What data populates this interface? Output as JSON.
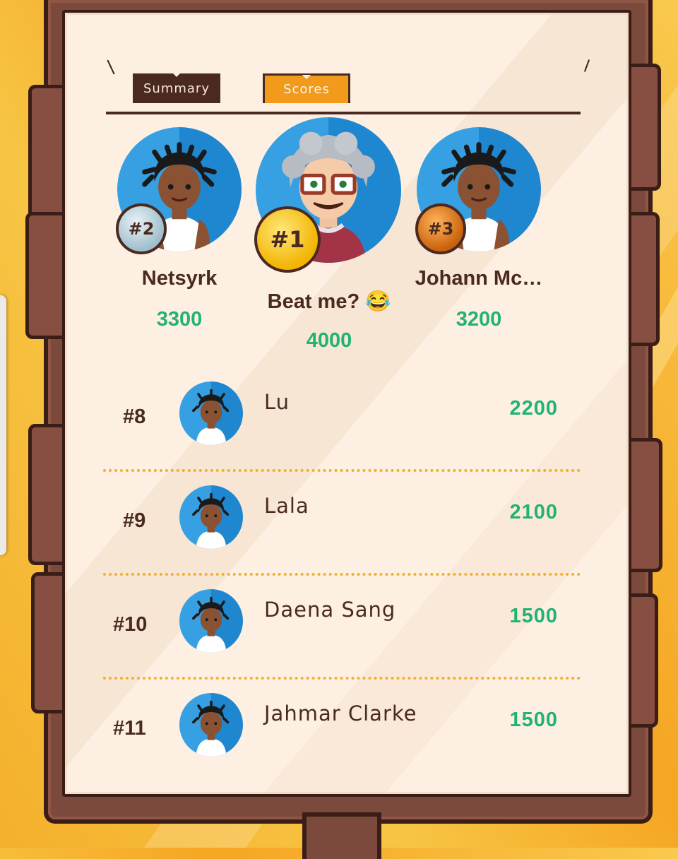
{
  "tabs": {
    "summary": "Summary",
    "scores": "Scores",
    "active": "Scores"
  },
  "podium": [
    {
      "rank_label": "#2",
      "name": "Netsyrk",
      "score": "3300",
      "medal": "silver"
    },
    {
      "rank_label": "#1",
      "name": "Beat me? 😂",
      "score": "4000",
      "medal": "gold"
    },
    {
      "rank_label": "#3",
      "name": "Johann Mc…",
      "score": "3200",
      "medal": "bronze"
    }
  ],
  "list": [
    {
      "rank_label": "#8",
      "name": "Lu",
      "score": "2200"
    },
    {
      "rank_label": "#9",
      "name": "Lala",
      "score": "2100"
    },
    {
      "rank_label": "#10",
      "name": "Daena Sang",
      "score": "1500"
    },
    {
      "rank_label": "#11",
      "name": "Jahmar Clarke",
      "score": "1500"
    }
  ],
  "colors": {
    "score_green": "#21b373",
    "wood": "#7c4a3c",
    "paper": "#fdf0e3",
    "active_tab": "#f29a1c",
    "inactive_tab": "#4a2921"
  },
  "icons": {
    "avatar_default": "girl-avatar-icon",
    "avatar_first": "grandma-avatar-icon"
  }
}
